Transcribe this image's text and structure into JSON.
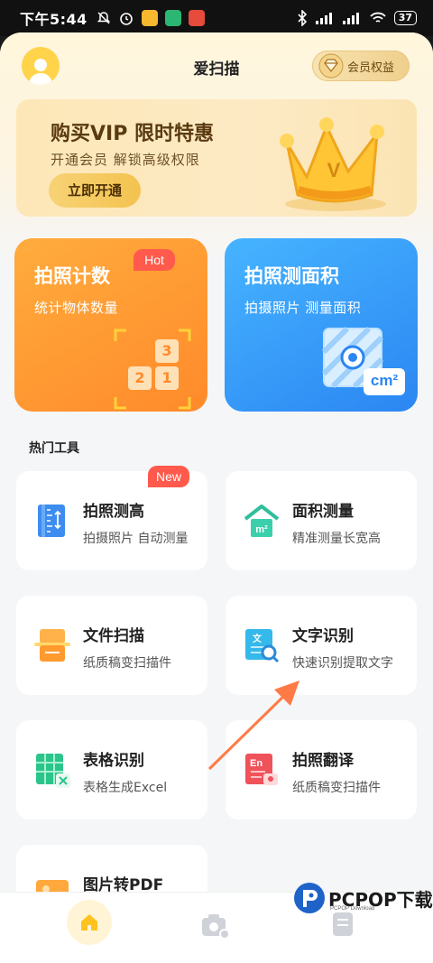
{
  "status_bar": {
    "time": "下午5:44",
    "battery": "37"
  },
  "header": {
    "title": "爱扫描",
    "vip_label": "会员权益"
  },
  "banner": {
    "title": "购买VIP 限时特惠",
    "subtitle": "开通会员 解锁高级权限",
    "button": "立即开通",
    "crown_letter": "V"
  },
  "feature_cards": [
    {
      "title": "拍照计数",
      "subtitle": "统计物体数量",
      "badge": "Hot",
      "numbers": [
        "3",
        "2",
        "1"
      ]
    },
    {
      "title": "拍照测面积",
      "subtitle": "拍摄照片 测量面积",
      "unit": "cm²"
    }
  ],
  "section_title": "热门工具",
  "tools": [
    {
      "title": "拍照测高",
      "subtitle": "拍摄照片 自动测量",
      "badge": "New",
      "icon": "ruler-height-icon"
    },
    {
      "title": "面积测量",
      "subtitle": "精准测量长宽高",
      "icon": "house-area-icon",
      "icon_text": "m²"
    },
    {
      "title": "文件扫描",
      "subtitle": "纸质稿变扫描件",
      "icon": "scanner-icon"
    },
    {
      "title": "文字识别",
      "subtitle": "快速识别提取文字",
      "icon": "text-recognition-icon",
      "icon_text": "文"
    },
    {
      "title": "表格识别",
      "subtitle": "表格生成Excel",
      "icon": "table-excel-icon"
    },
    {
      "title": "拍照翻译",
      "subtitle": "纸质稿变扫描件",
      "icon": "translate-icon",
      "icon_text": "En"
    },
    {
      "title": "图片转PDF",
      "subtitle": "",
      "icon": "image-pdf-icon"
    }
  ],
  "watermark": {
    "brand": "PCPOP下载",
    "small": "PCPOP Download"
  },
  "colors": {
    "accent_orange": "#ff8a2a",
    "accent_blue": "#2b86f2",
    "badge_red": "#ff5a4c",
    "arrow": "#ff7a45"
  }
}
